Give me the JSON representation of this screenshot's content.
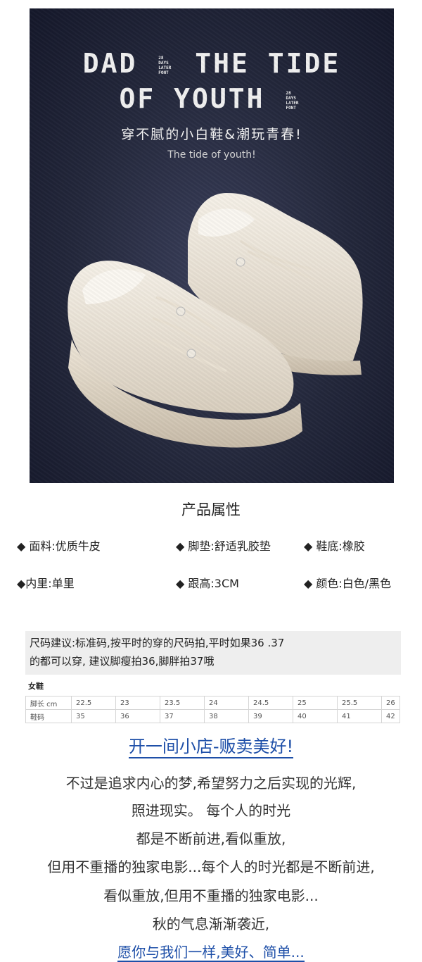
{
  "hero": {
    "title_line1_left": "DAD",
    "title_line1_right": "THE TIDE",
    "title_line2": "OF YOUTH",
    "mini_text": "28 DAYS LATER FONT",
    "subtitle_cn": "穿不腻的小白鞋&潮玩青春!",
    "subtitle_en": "The tide of youth!"
  },
  "attributes": {
    "title": "产品属性",
    "items": [
      "◆ 面料:优质牛皮",
      "◆ 脚垫:舒适乳胶垫",
      "◆ 鞋底:橡胶",
      "◆内里:单里",
      "◆ 跟高:3CM",
      "◆ 颜色:白色/黑色"
    ]
  },
  "size_suggestion": {
    "line1": "尺码建议:标准码,按平时的穿的尺码拍,平时如果36 .37",
    "line2": "的都可以穿, 建议脚瘦拍36,脚胖拍37哦"
  },
  "size_table": {
    "title": "女鞋",
    "rows": [
      [
        "脚长 cm",
        "22.5",
        "23",
        "23.5",
        "24",
        "24.5",
        "25",
        "25.5",
        "26"
      ],
      [
        "鞋码",
        "35",
        "36",
        "37",
        "38",
        "39",
        "40",
        "41",
        "42"
      ]
    ]
  },
  "headline": "开一间小店-贩卖美好!",
  "paragraph": [
    "不过是追求内心的梦,希望努力之后实现的光辉,",
    "照进现实。 每个人的时光",
    "都是不断前进,看似重放,",
    "但用不重播的独家电影...每个人的时光都是不断前进,",
    "看似重放,但用不重播的独家电影...",
    "秋的气息渐渐袭近,",
    "愿你与我们一样,美好、简单..."
  ],
  "colors": {
    "accent_blue": "#1e4fa8",
    "hero_bg": "#23273b",
    "shoe": "#efe8dc"
  }
}
